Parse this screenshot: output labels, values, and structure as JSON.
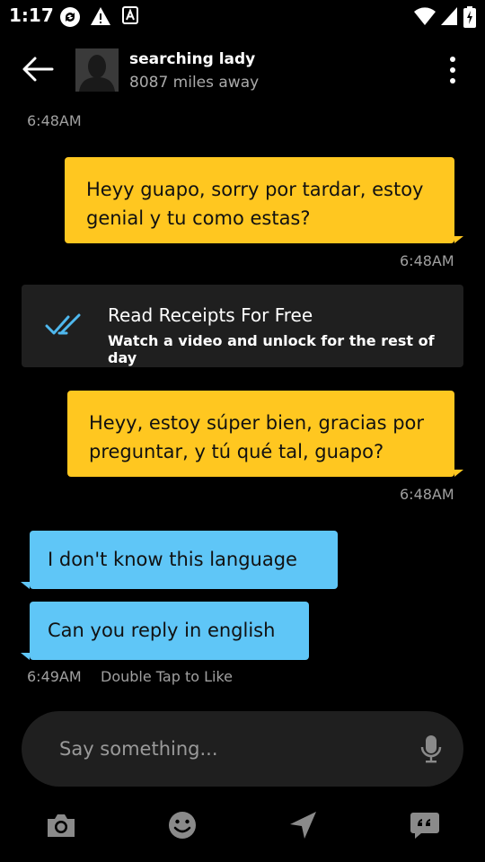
{
  "status_bar": {
    "time": "1:17"
  },
  "header": {
    "name": "searching lady",
    "distance": "8087 miles away"
  },
  "messages": {
    "first_timestamp": "6:48AM",
    "outgoing_1": {
      "text": "Heyy guapo, sorry por tardar, estoy genial y tu como estas?",
      "time": "6:48AM"
    },
    "receipts_banner": {
      "title": "Read Receipts For Free",
      "subtitle": "Watch a video and unlock for the rest of day"
    },
    "outgoing_2": {
      "text": "Heyy, estoy súper bien, gracias por preguntar, y tú qué tal, guapo?",
      "time": "6:48AM"
    },
    "incoming_1": {
      "text": "I don't know this language"
    },
    "incoming_2": {
      "text": "Can you reply in english"
    },
    "incoming_time": "6:49AM",
    "like_hint": "Double Tap to Like"
  },
  "composer": {
    "placeholder": "Say something..."
  },
  "toolbar": {
    "icons": [
      "camera-icon",
      "emoji-icon",
      "location-icon",
      "saved-phrases-icon"
    ]
  },
  "colors": {
    "outgoing_bubble": "#ffc720",
    "incoming_bubble": "#5fc6f7",
    "panel": "#1f1f1f",
    "receipt_check": "#4fb8ee"
  }
}
